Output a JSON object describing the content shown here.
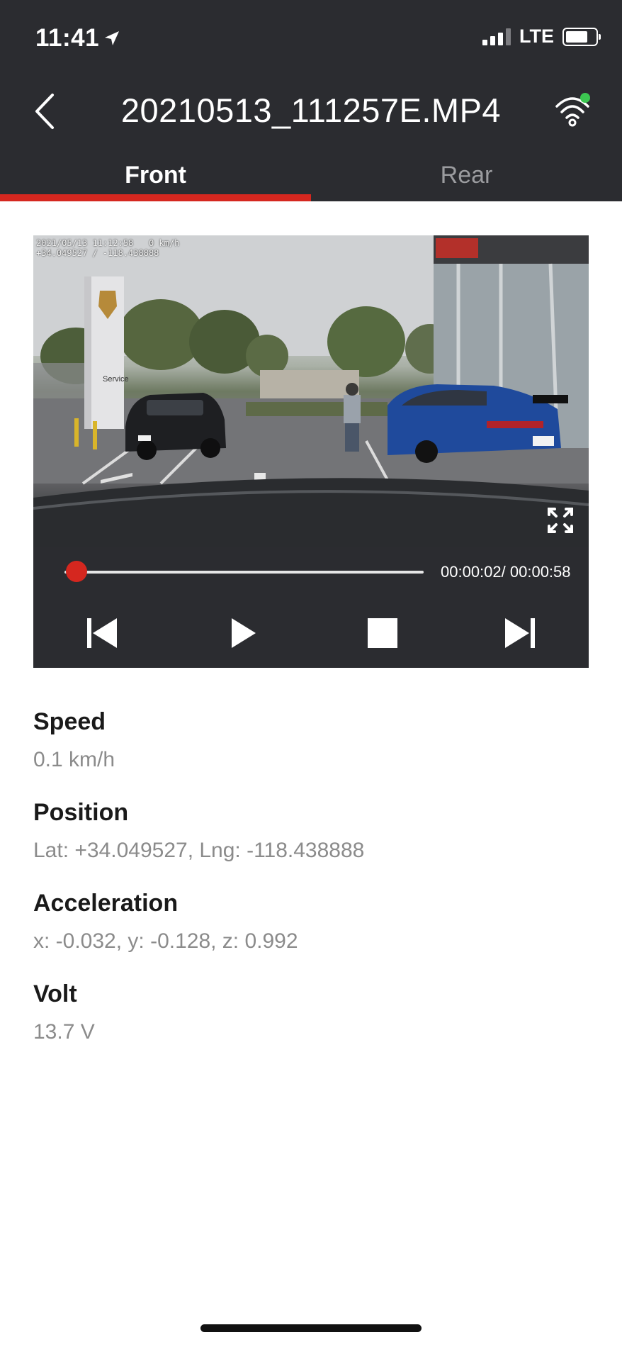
{
  "status_bar": {
    "time": "11:41",
    "network": "LTE"
  },
  "header": {
    "title": "20210513_111257E.MP4"
  },
  "tabs": [
    {
      "label": "Front",
      "active": true
    },
    {
      "label": "Rear",
      "active": false
    }
  ],
  "video": {
    "overlay_line1": "2021/05/13 11:12:58   0 km/h",
    "overlay_line2": "+34.049527 / -118.438888",
    "sign_text": "Service",
    "progress_fraction": 0.034,
    "current_time": "00:00:02/",
    "total_time": "00:00:58"
  },
  "info": [
    {
      "label": "Speed",
      "value": "0.1 km/h"
    },
    {
      "label": "Position",
      "value": "Lat: +34.049527, Lng: -118.438888"
    },
    {
      "label": "Acceleration",
      "value": "x: -0.032, y: -0.128, z: 0.992"
    },
    {
      "label": "Volt",
      "value": "13.7 V"
    }
  ],
  "colors": {
    "accent": "#d5271f",
    "bar_bg": "#2b2c30",
    "wifi_dot": "#3cc651"
  },
  "icons": [
    "location-arrow-icon",
    "signal-icon",
    "battery-icon",
    "back-icon",
    "wifi-icon",
    "fullscreen-icon",
    "previous-icon",
    "play-icon",
    "stop-icon",
    "next-icon"
  ]
}
